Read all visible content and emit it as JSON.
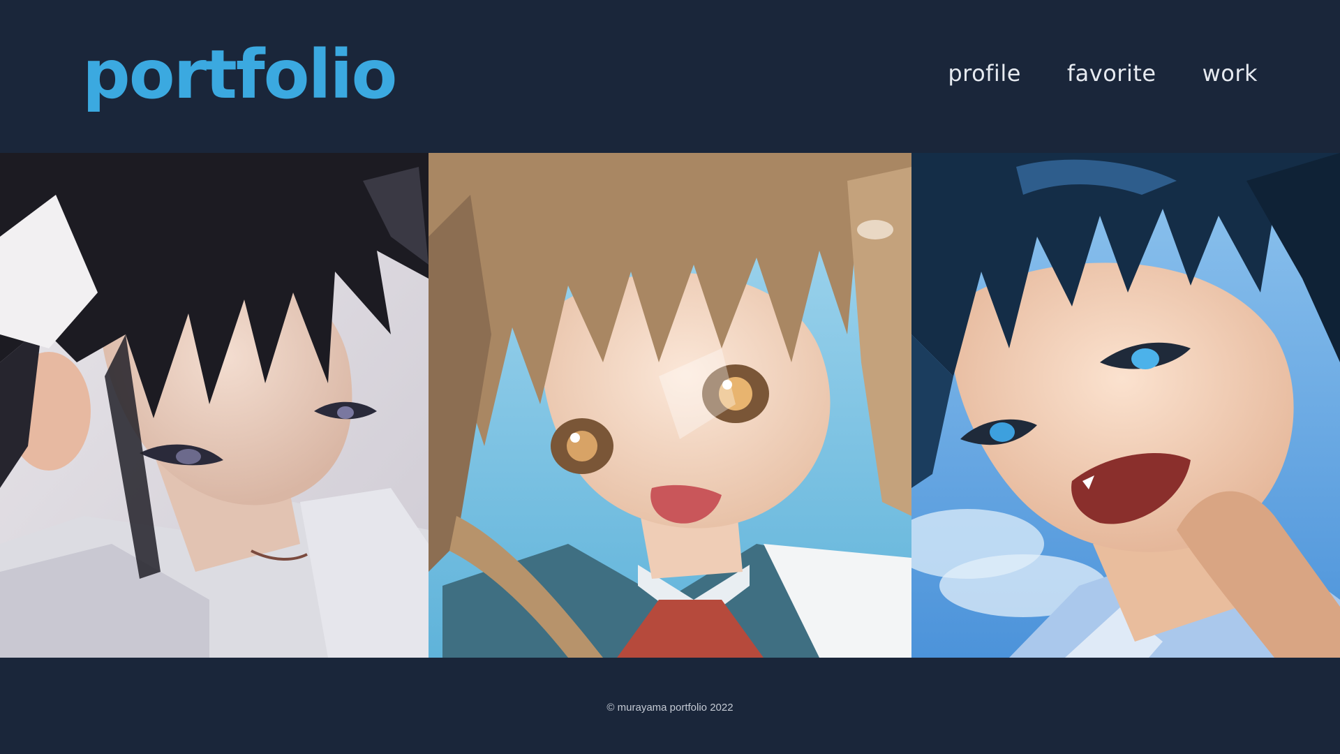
{
  "header": {
    "logo": "portfolio",
    "nav": [
      "profile",
      "favorite",
      "work"
    ]
  },
  "gallery": {
    "items": [
      {
        "name": "illustration-boy-black-hair"
      },
      {
        "name": "illustration-girl-twintails"
      },
      {
        "name": "illustration-boy-blue-hair"
      }
    ]
  },
  "footer": {
    "copyright": "© murayama portfolio 2022"
  },
  "colors": {
    "background": "#1a263a",
    "accent": "#3ba9e0",
    "nav_text": "#e6eaf0"
  }
}
